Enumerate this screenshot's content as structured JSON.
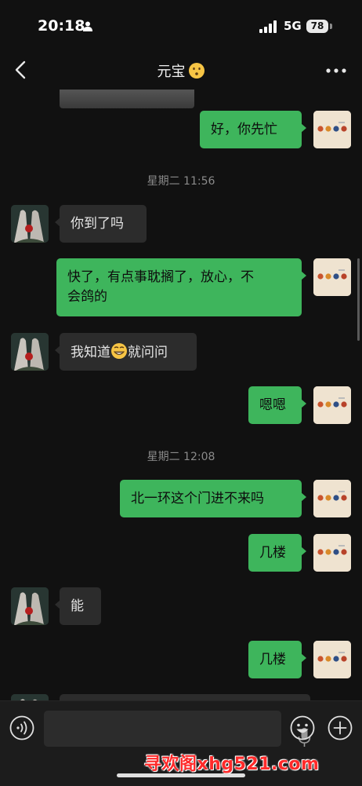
{
  "status_bar": {
    "time": "20:18",
    "network": "5G",
    "battery": "78"
  },
  "header": {
    "title": "元宝",
    "title_emoji": "kissing-face"
  },
  "messages": [
    {
      "type": "timestamp",
      "text": "星期二 11:56"
    },
    {
      "type": "text",
      "sender": "them",
      "text": "你到了吗"
    },
    {
      "type": "text",
      "sender": "me",
      "line1": "快了，有点事耽搁了，放心，不",
      "line2": "会鸽的"
    },
    {
      "type": "text",
      "sender": "them",
      "before_emoji": "我知道",
      "emoji": "grinning-face",
      "after_emoji": "就问问"
    },
    {
      "type": "text",
      "sender": "me",
      "text": "嗯嗯"
    },
    {
      "type": "timestamp",
      "text": "星期二 12:08"
    },
    {
      "type": "text",
      "sender": "me",
      "text": "北一环这个门进不来吗"
    },
    {
      "type": "text",
      "sender": "me",
      "text": "几楼"
    },
    {
      "type": "text",
      "sender": "them",
      "text": "能"
    },
    {
      "type": "text",
      "sender": "me",
      "text": "几楼"
    }
  ],
  "top_partial": {
    "me_message": "好，你先忙"
  },
  "input_bar": {
    "placeholder": ""
  },
  "watermark": "寻欢阁xhg521.com",
  "colors": {
    "my_bubble": "#3eb55c",
    "their_bubble": "#2c2c2c",
    "background": "#111111"
  }
}
